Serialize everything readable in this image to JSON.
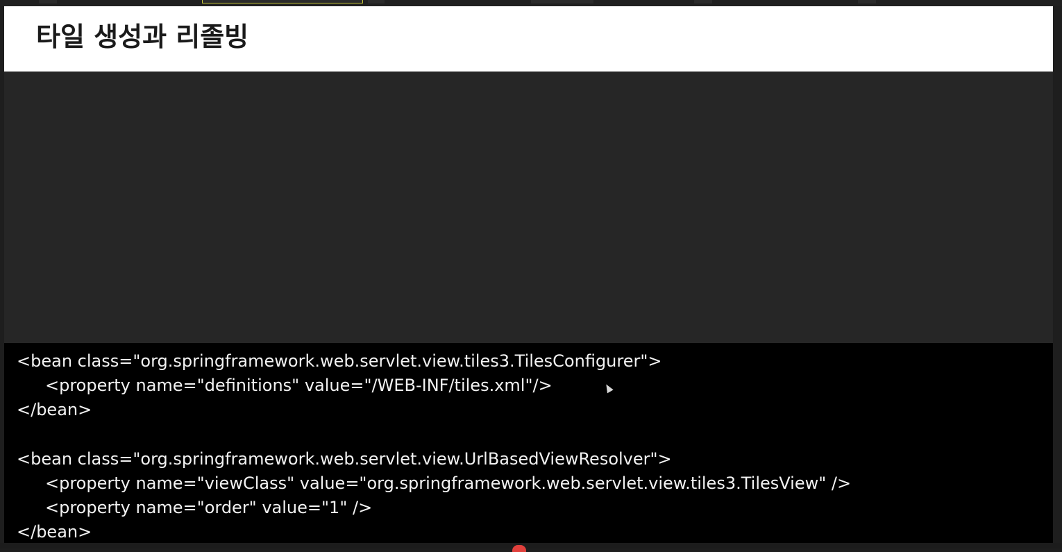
{
  "slide": {
    "title": "타일 생성과 리졸빙",
    "code_lines": [
      "<bean class=\"org.springframework.web.servlet.view.tiles3.TilesConfigurer\">",
      "<property name=\"definitions\" value=\"/WEB-INF/tiles.xml\"/>",
      "</bean>",
      "<bean class=\"org.springframework.web.servlet.view.UrlBasedViewResolver\">",
      "<property name=\"viewClass\" value=\"org.springframework.web.servlet.view.tiles3.TilesView\" />",
      "<property name=\"order\" value=\"1\" />",
      "</bean>"
    ]
  },
  "colors": {
    "title_bg": "#ffffff",
    "slide_bg": "#262626",
    "code_bg": "#000000",
    "code_text": "#f2f2f2"
  },
  "icons": {
    "pointer": "mouse-cursor-icon"
  }
}
